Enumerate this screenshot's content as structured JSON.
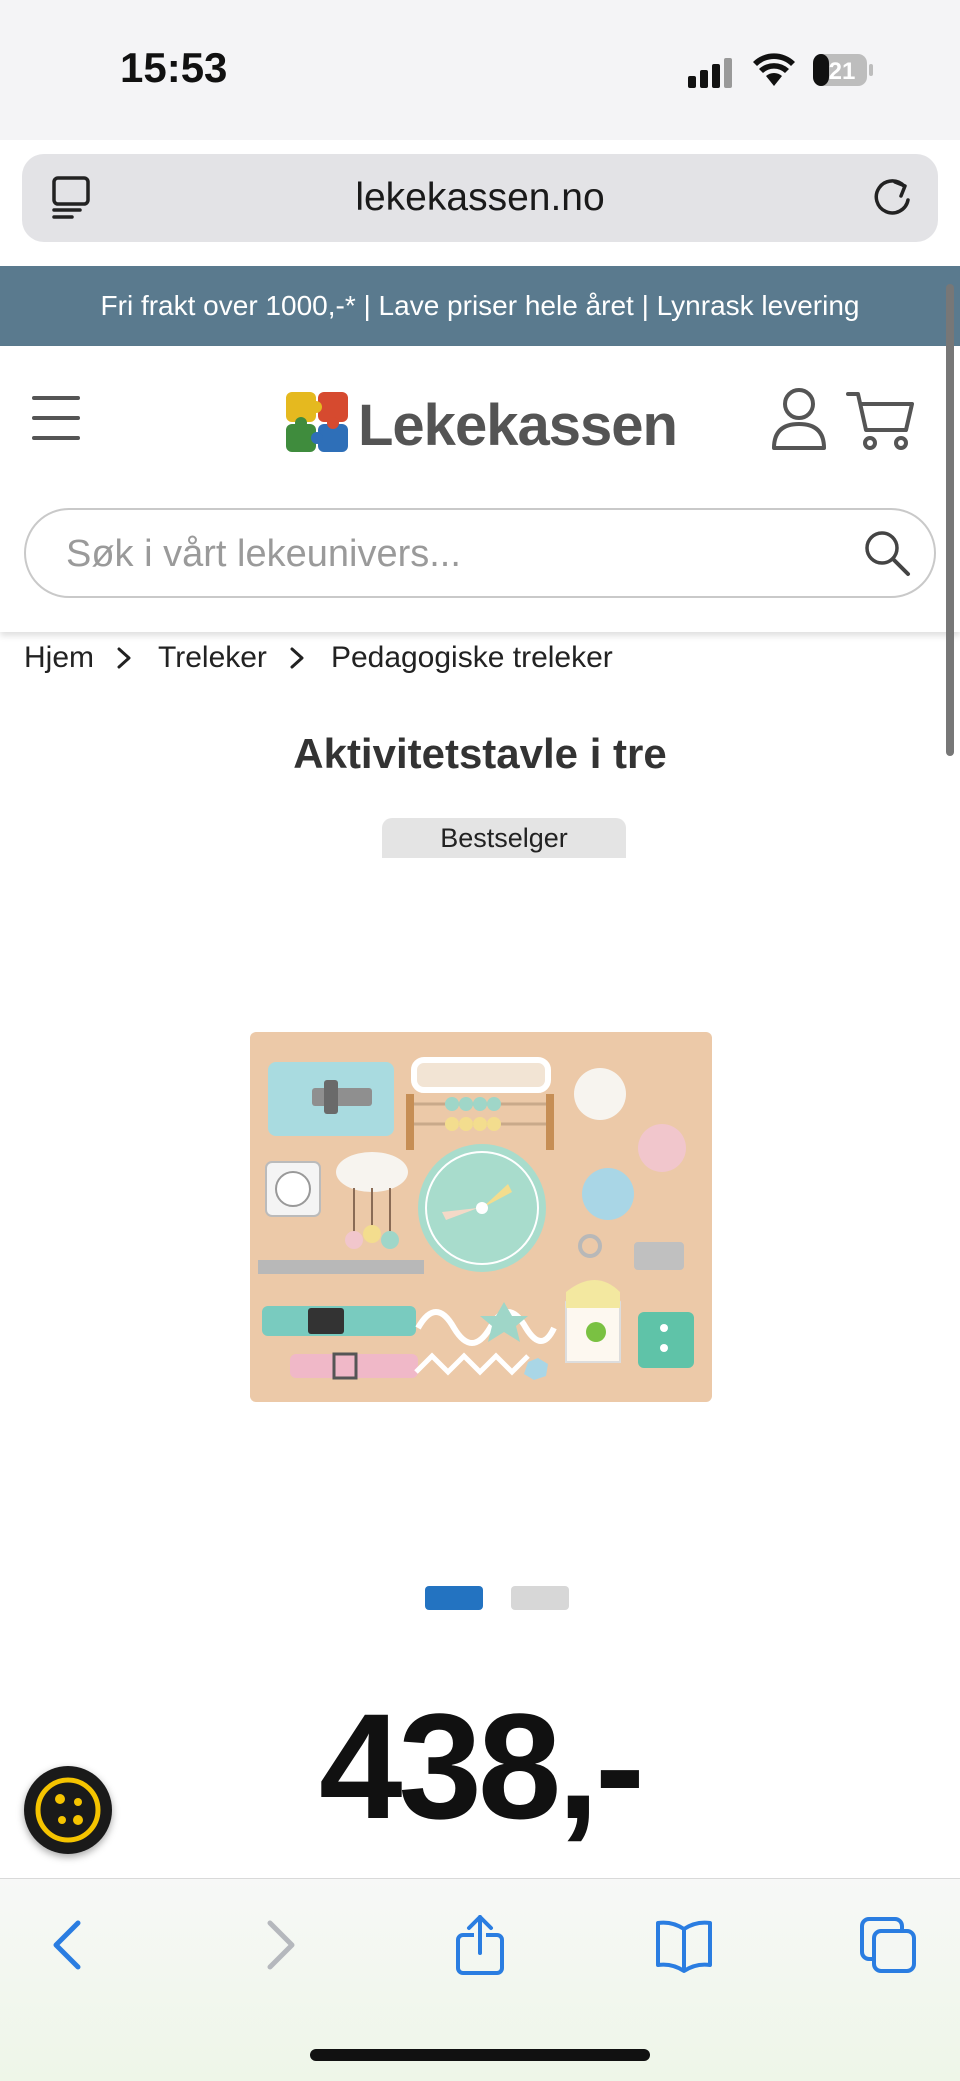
{
  "status_bar": {
    "time": "15:53",
    "battery": "21"
  },
  "browser": {
    "url": "lekekassen.no"
  },
  "promo": {
    "text": "Fri frakt over 1000,-* | Lave priser hele året | Lynrask levering"
  },
  "header": {
    "logo_text": "Lekekassen",
    "search_placeholder": "Søk i vårt lekeunivers..."
  },
  "breadcrumb": [
    "Hjem",
    "Treleker",
    "Pedagogiske treleker"
  ],
  "product": {
    "title": "Aktivitetstavle i tre",
    "badge": "Bestselger",
    "price": "438,-",
    "image_count": 2,
    "active_image": 1
  },
  "colors": {
    "promo_bg": "#5a7a8e",
    "accent": "#2373c1",
    "cookie_button": "#f5c400"
  },
  "icons": [
    "tabs-icon",
    "reload-icon",
    "menu-icon",
    "user-icon",
    "cart-icon",
    "search-icon",
    "chevron-right-icon",
    "cookie-icon",
    "back-icon",
    "forward-icon",
    "share-icon",
    "bookmarks-icon",
    "tabs-overview-icon"
  ]
}
